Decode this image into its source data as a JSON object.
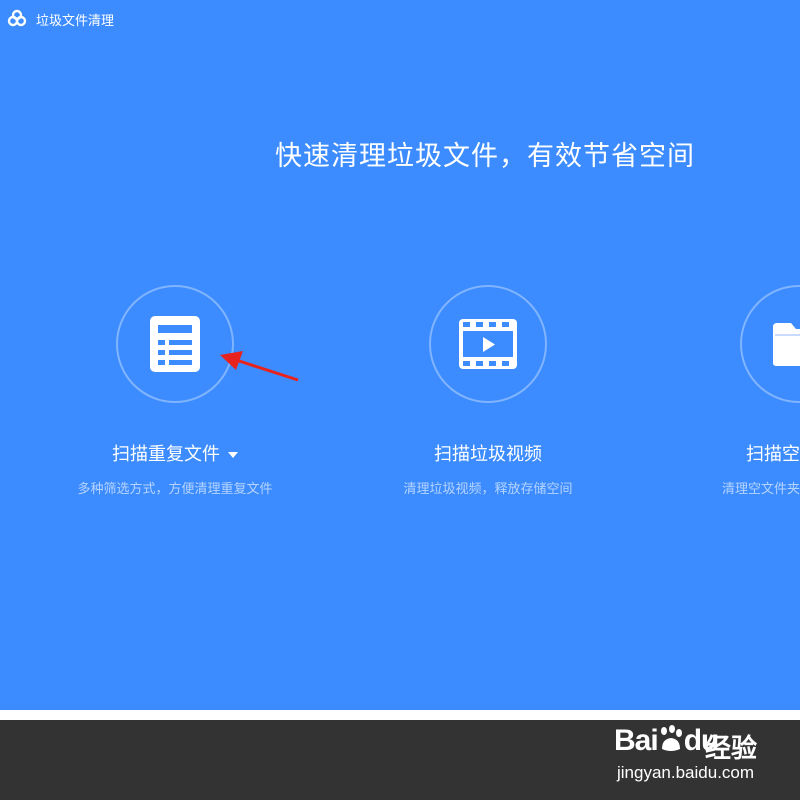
{
  "window": {
    "title": "垃圾文件清理",
    "logo_icon": "baidu-cloud-icon"
  },
  "headline": "快速清理垃圾文件，有效节省空间",
  "features": [
    {
      "label": "扫描重复文件",
      "desc": "多种筛选方式，方便清理重复文件",
      "icon": "document-list-icon",
      "has_dropdown": true
    },
    {
      "label": "扫描垃圾视频",
      "desc": "清理垃圾视频，释放存储空间",
      "icon": "video-icon",
      "has_dropdown": false
    },
    {
      "label": "扫描空文件夹",
      "desc": "清理空文件夹，文件更整洁",
      "icon": "folder-icon",
      "has_dropdown": false
    }
  ],
  "watermark": {
    "brand": "Bai",
    "brand_du": "du",
    "product": "经验",
    "url": "jingyan.baidu.com"
  },
  "colors": {
    "background": "#3c8cff",
    "footer": "#333333",
    "annotation_arrow": "#e8231e"
  }
}
